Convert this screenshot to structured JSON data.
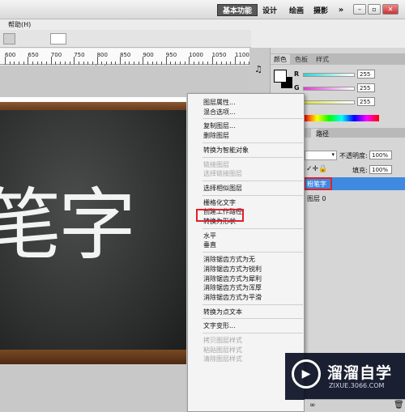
{
  "titlebar": {
    "workspaces": [
      "基本功能",
      "设计",
      "绘画",
      "摄影"
    ],
    "more": "»",
    "window_buttons": [
      "–",
      "▫",
      "✕"
    ]
  },
  "menubar": {
    "help": "帮助(H)"
  },
  "ruler": {
    "labels": [
      "600",
      "650",
      "700",
      "750",
      "800",
      "850",
      "900",
      "950",
      "1000",
      "1050",
      "1100"
    ]
  },
  "canvas": {
    "text": "笔字"
  },
  "color_panel": {
    "tabs": [
      "颜色",
      "色板",
      "样式"
    ],
    "rows": [
      {
        "label": "R",
        "value": "255",
        "color": "#ff3b3b"
      },
      {
        "label": "G",
        "value": "255",
        "color": "#e83ad6"
      },
      {
        "label": "B",
        "value": "255",
        "color": "#cfd83a"
      }
    ]
  },
  "layers_panel": {
    "tab": "路径",
    "opacity_label": "不透明度:",
    "opacity_value": "100%",
    "fill_label": "填充:",
    "fill_value": "100%",
    "layers": [
      "粉笔字",
      "图层 0"
    ]
  },
  "context_menu": {
    "items": [
      {
        "label": "图层属性...",
        "disabled": false
      },
      {
        "label": "混合选项...",
        "disabled": false
      },
      {
        "sep": true
      },
      {
        "label": "复制图层...",
        "disabled": false
      },
      {
        "label": "删除图层",
        "disabled": false
      },
      {
        "sep": true
      },
      {
        "label": "转换为智能对象",
        "disabled": false
      },
      {
        "sep": true
      },
      {
        "label": "链接图层",
        "disabled": true
      },
      {
        "label": "选择链接图层",
        "disabled": true
      },
      {
        "sep": true
      },
      {
        "label": "选择相似图层",
        "disabled": false
      },
      {
        "sep": true
      },
      {
        "label": "栅格化文字",
        "disabled": false
      },
      {
        "label": "创建工作路径",
        "disabled": false
      },
      {
        "label": "转换为形状",
        "disabled": false
      },
      {
        "sep": true
      },
      {
        "label": "水平",
        "disabled": false
      },
      {
        "label": "垂直",
        "disabled": false
      },
      {
        "sep": true
      },
      {
        "label": "消除锯齿方式为无",
        "disabled": false
      },
      {
        "label": "消除锯齿方式为锐利",
        "disabled": false
      },
      {
        "label": "消除锯齿方式为犀利",
        "disabled": false
      },
      {
        "label": "消除锯齿方式为浑厚",
        "disabled": false
      },
      {
        "label": "消除锯齿方式为平滑",
        "disabled": false
      },
      {
        "sep": true
      },
      {
        "label": "转换为点文本",
        "disabled": false
      },
      {
        "sep": true
      },
      {
        "label": "文字变形...",
        "disabled": false
      },
      {
        "sep": true
      },
      {
        "label": "拷贝图层样式",
        "disabled": true
      },
      {
        "label": "粘贴图层样式",
        "disabled": true
      },
      {
        "label": "清除图层样式",
        "disabled": true
      }
    ]
  },
  "watermark": {
    "title": "溜溜自学",
    "url": "ZIXUE.3066.COM"
  }
}
